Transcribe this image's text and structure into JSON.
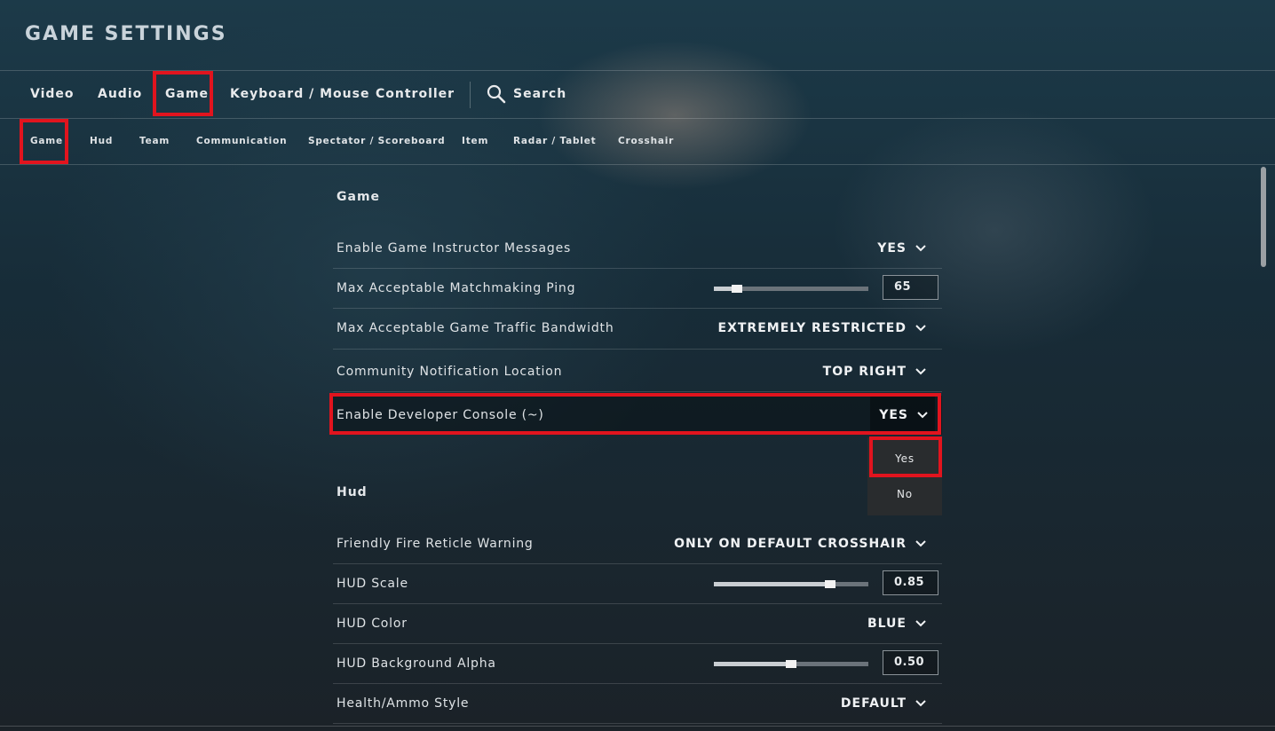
{
  "title": "GAME SETTINGS",
  "tabs": [
    {
      "label": "Video"
    },
    {
      "label": "Audio"
    },
    {
      "label": "Game"
    },
    {
      "label": "Keyboard / Mouse"
    },
    {
      "label": "Controller"
    },
    {
      "label": "Search"
    }
  ],
  "subtabs": [
    {
      "label": "Game"
    },
    {
      "label": "Hud"
    },
    {
      "label": "Team"
    },
    {
      "label": "Communication"
    },
    {
      "label": "Spectator / Scoreboard"
    },
    {
      "label": "Item"
    },
    {
      "label": "Radar / Tablet"
    },
    {
      "label": "Crosshair"
    }
  ],
  "active_tab": "Game",
  "active_subtab": "Game",
  "sections": {
    "game": {
      "title": "Game",
      "rows": [
        {
          "label": "Enable Game Instructor Messages",
          "value": "YES"
        },
        {
          "label": "Max Acceptable Matchmaking Ping",
          "value": "65",
          "slider_fraction": 0.15
        },
        {
          "label": "Max Acceptable Game Traffic Bandwidth",
          "value": "EXTREMELY RESTRICTED"
        },
        {
          "label": "Community Notification Location",
          "value": "TOP RIGHT"
        },
        {
          "label": "Enable Developer Console (~)",
          "value": "YES"
        }
      ]
    },
    "hud": {
      "title": "Hud",
      "rows": [
        {
          "label": "Friendly Fire Reticle Warning",
          "value": "ONLY ON DEFAULT CROSSHAIR"
        },
        {
          "label": "HUD Scale",
          "value": "0.85",
          "slider_fraction": 0.75
        },
        {
          "label": "HUD Color",
          "value": "BLUE"
        },
        {
          "label": "HUD Background Alpha",
          "value": "0.50",
          "slider_fraction": 0.5
        },
        {
          "label": "Health/Ammo Style",
          "value": "DEFAULT"
        }
      ]
    }
  },
  "dropdown": {
    "options": [
      "Yes",
      "No"
    ],
    "selected": "Yes"
  },
  "colors": {
    "highlight": "#e1141e",
    "text": "#e6e8ea"
  }
}
